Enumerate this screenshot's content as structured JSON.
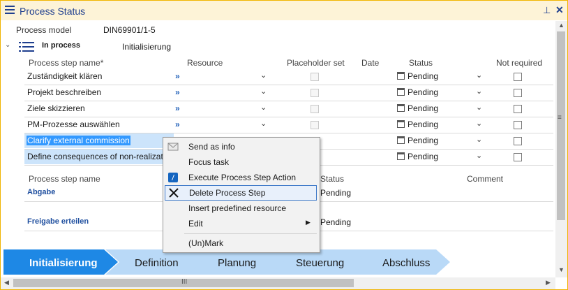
{
  "window": {
    "title": "Process Status"
  },
  "process": {
    "model_label": "Process model",
    "model_value": "DIN69901/1-5",
    "status_label": "In process",
    "status_value": "Initialisierung"
  },
  "table1": {
    "headers": {
      "name": "Process step name*",
      "resource": "Resource",
      "placeholder": "Placeholder set",
      "date": "Date",
      "status": "Status",
      "not_required": "Not required"
    },
    "rows": [
      {
        "name": "Zuständigkeit klären",
        "status": "Pending"
      },
      {
        "name": "Projekt beschreiben",
        "status": "Pending"
      },
      {
        "name": "Ziele skizzieren",
        "status": "Pending"
      },
      {
        "name": "PM-Prozesse auswählen",
        "status": "Pending"
      },
      {
        "name": "Clarify external commission",
        "status": "Pending"
      },
      {
        "name": "Define consequences of non-realization",
        "status": "Pending"
      }
    ]
  },
  "table2": {
    "headers": {
      "name": "Process step name",
      "status": "Status",
      "comment": "Comment"
    },
    "rows": [
      {
        "name": "Abgabe",
        "status": "Pending"
      },
      {
        "name": "Freigabe erteilen",
        "status": "Pending"
      }
    ]
  },
  "context_menu": {
    "items": [
      {
        "label": "Send as info",
        "icon": "envelope-icon"
      },
      {
        "label": "Focus task",
        "icon": ""
      },
      {
        "label": "Execute Process Step Action",
        "icon": "action-icon"
      },
      {
        "label": "Delete Process Step",
        "icon": "delete-x-icon"
      },
      {
        "label": "Insert predefined resource",
        "icon": ""
      },
      {
        "label": "Edit",
        "icon": "submenu-arrow-icon"
      },
      {
        "label": "(Un)Mark",
        "icon": ""
      }
    ]
  },
  "phases": [
    "Initialisierung",
    "Definition",
    "Planung",
    "Steuerung",
    "Abschluss"
  ],
  "colors": {
    "accent": "#1f3f8f",
    "title_bg": "#fdf3d7",
    "active_phase": "#1e88e5",
    "inactive_phase": "#b9d9f7"
  }
}
